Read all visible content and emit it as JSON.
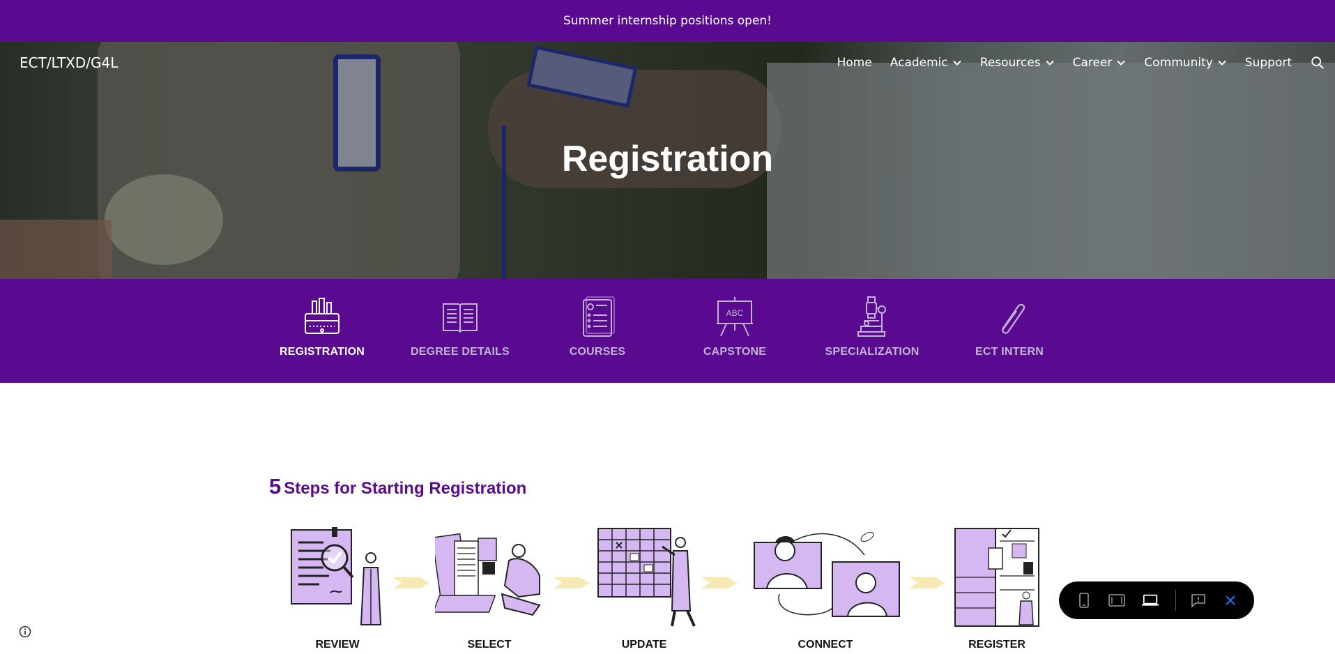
{
  "announcement": "Summer internship positions open!",
  "site_title": "ECT/LTXD/G4L",
  "nav": {
    "items": [
      {
        "label": "Home",
        "has_dropdown": false
      },
      {
        "label": "Academic",
        "has_dropdown": true
      },
      {
        "label": "Resources",
        "has_dropdown": true
      },
      {
        "label": "Career",
        "has_dropdown": true
      },
      {
        "label": "Community",
        "has_dropdown": true
      },
      {
        "label": "Support",
        "has_dropdown": false
      }
    ],
    "search_icon": "search-icon"
  },
  "hero": {
    "title": "Registration"
  },
  "tabs": [
    {
      "label": "REGISTRATION",
      "icon": "pencil-case-icon",
      "active": true
    },
    {
      "label": "DEGREE DETAILS",
      "icon": "open-book-icon",
      "active": false
    },
    {
      "label": "COURSES",
      "icon": "checklist-icon",
      "active": false
    },
    {
      "label": "CAPSTONE",
      "icon": "easel-board-icon",
      "active": false
    },
    {
      "label": "SPECIALIZATION",
      "icon": "microscope-icon",
      "active": false
    },
    {
      "label": "ECT INTERN",
      "icon": "paperclip-icon",
      "active": false
    }
  ],
  "steps_section": {
    "heading_number": "5",
    "heading_text": "Steps for Starting Registration",
    "steps": [
      {
        "label": "REVIEW",
        "icon": "review-document-illustration"
      },
      {
        "label": "SELECT",
        "icon": "select-courses-illustration"
      },
      {
        "label": "UPDATE",
        "icon": "update-calendar-illustration"
      },
      {
        "label": "CONNECT",
        "icon": "connect-phone-illustration"
      },
      {
        "label": "REGISTER",
        "icon": "register-shelves-illustration"
      }
    ]
  },
  "toolbar": {
    "buttons": [
      "phone-preview-icon",
      "tablet-preview-icon",
      "laptop-preview-icon",
      "report-abuse-icon",
      "close-icon"
    ]
  },
  "colors": {
    "brand_purple": "#5a0a91",
    "illustration_lavender": "#d5b8f2",
    "arrow_yellow": "#f6e9b3"
  }
}
